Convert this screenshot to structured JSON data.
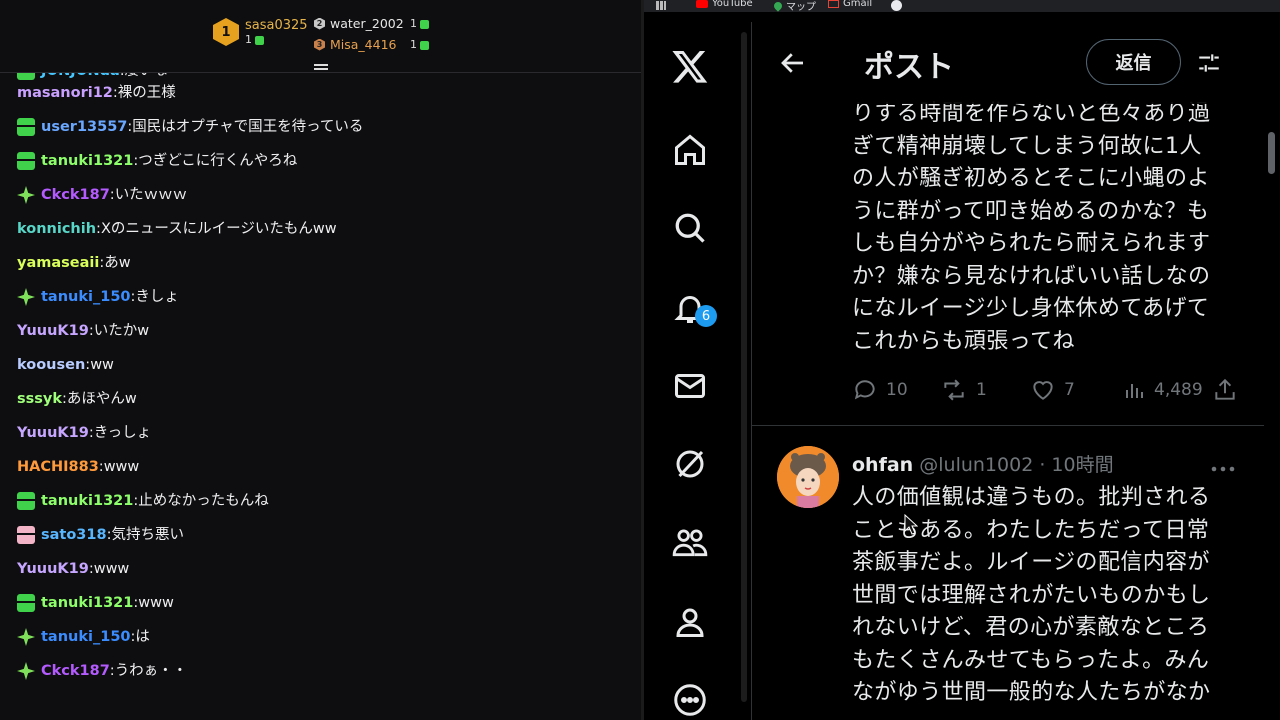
{
  "leaderboard": {
    "first": {
      "rank": "1",
      "name": "sasa0325",
      "count": "1"
    },
    "second": {
      "rank": "2",
      "name": "water_2002",
      "count": "1"
    },
    "third": {
      "rank": "3",
      "name": "Misa_4416",
      "count": "1"
    }
  },
  "chat": {
    "messages": [
      {
        "badge": "gift",
        "user": "JUNJUNda",
        "color": "#47c7ff",
        "text": "凄いな"
      },
      {
        "badge": "",
        "user": "masanori12",
        "color": "#c9a0ff",
        "text": "裸の王様"
      },
      {
        "badge": "gift",
        "user": "user13557",
        "color": "#6aa7ff",
        "text": "国民はオプチャで国王を待っている"
      },
      {
        "badge": "gift",
        "user": "tanuki1321",
        "color": "#8dff6a",
        "text": "つぎどこに行くんやろね"
      },
      {
        "badge": "star",
        "user": "Ckck187",
        "color": "#b45bff",
        "text": "いたｗｗｗ"
      },
      {
        "badge": "",
        "user": "konnichih",
        "color": "#58d6c8",
        "text": "Xのニュースにルイージいたもんww"
      },
      {
        "badge": "",
        "user": "yamaseaii",
        "color": "#d9ff5a",
        "text": "あw"
      },
      {
        "badge": "star",
        "user": "tanuki_150",
        "color": "#3a8cff",
        "text": "きしょ"
      },
      {
        "badge": "",
        "user": "YuuuK19",
        "color": "#c6a6ff",
        "text": "いたかw"
      },
      {
        "badge": "",
        "user": "koousen",
        "color": "#b8ccff",
        "text": "ww"
      },
      {
        "badge": "",
        "user": "sssyk",
        "color": "#9fff7a",
        "text": "あほやんw"
      },
      {
        "badge": "",
        "user": "YuuuK19",
        "color": "#c6a6ff",
        "text": "きっしょ"
      },
      {
        "badge": "",
        "user": "HACHI883",
        "color": "#ff9a3c",
        "text": "www"
      },
      {
        "badge": "gift",
        "user": "tanuki1321",
        "color": "#8dff6a",
        "text": "止めなかったもんね"
      },
      {
        "badge": "gift-pink",
        "user": "sato318",
        "color": "#58b6ff",
        "text": "気持ち悪い"
      },
      {
        "badge": "",
        "user": "YuuuK19",
        "color": "#c6a6ff",
        "text": "www"
      },
      {
        "badge": "gift",
        "user": "tanuki1321",
        "color": "#8dff6a",
        "text": "www"
      },
      {
        "badge": "star",
        "user": "tanuki_150",
        "color": "#3a8cff",
        "text": "は"
      },
      {
        "badge": "star",
        "user": "Ckck187",
        "color": "#b45bff",
        "text": "うわぁ・・"
      }
    ]
  },
  "bookmarks": {
    "youtube": "YouTube",
    "maps": "マップ",
    "gmail": "Gmail"
  },
  "nav": {
    "icons": [
      "x-logo-icon",
      "home-icon",
      "search-icon",
      "bell-icon",
      "mail-icon",
      "grok-icon",
      "communities-icon",
      "profile-icon",
      "more-circle-icon"
    ],
    "notification_count": "6"
  },
  "header": {
    "title": "ポスト",
    "reply_button": "返信"
  },
  "tweet1": {
    "text": "りする時間を作らないと色々あり過\nぎて精神崩壊してしまう何故に1人\nの人が騒ぎ初めるとそこに小蝿のよ\nうに群がって叩き始めるのかな？も\nしも自分がやられたら耐えられます\nか？嫌なら見なければいい話しなの\nになルイージ少し身体休めてあげて\nこれからも頑張ってね",
    "replies": "10",
    "reposts": "1",
    "likes": "7",
    "views": "4,489"
  },
  "tweet2": {
    "name": "ohfan",
    "handle": "@lulun1002",
    "separator": " · ",
    "time": "10時間",
    "text": "人の価値観は違うもの。批判される\nこともある。わたしたちだって日常\n茶飯事だよ。ルイージの配信内容が\n世間では理解されがたいものかもし\nれないけど、君の心が素敵なところ\nもたくさんみせてもらったよ。みん\nながゆう世間一般的な人たちがなか"
  },
  "colors": {
    "accent": "#1d9bf0",
    "chat_bg": "#0e0e10",
    "x_bg": "#000000",
    "gift_green": "#3fd24a"
  }
}
